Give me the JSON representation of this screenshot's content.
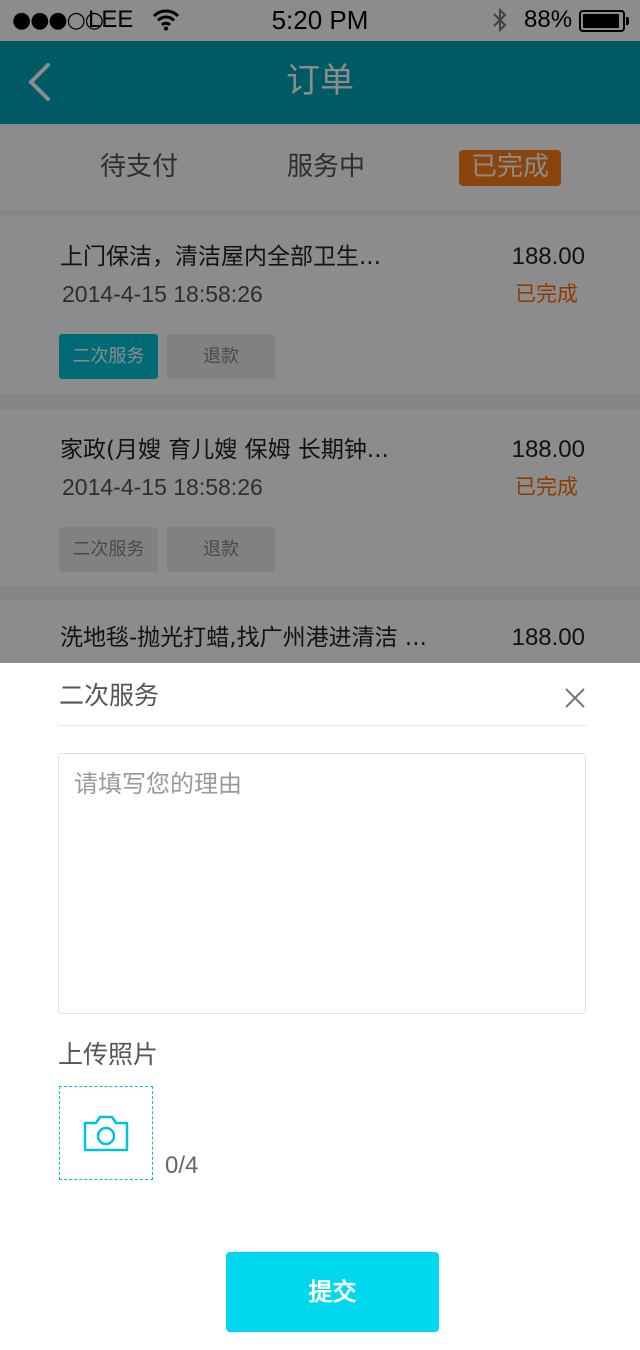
{
  "status_bar": {
    "signal": "●●●○○",
    "carrier": "LEE",
    "time": "5:20 PM",
    "battery_percent": "88%",
    "battery_level": 0.88
  },
  "nav": {
    "title": "订单",
    "back_icon": "chevron-left-icon"
  },
  "tabs": [
    {
      "label": "待支付",
      "active": false
    },
    {
      "label": "服务中",
      "active": false
    },
    {
      "label": "已完成",
      "active": true
    }
  ],
  "orders": [
    {
      "name": "上门保洁，清洁屋内全部卫生...",
      "date": "2014-4-15   18:58:26",
      "price": "188.00",
      "status": "已完成",
      "actions": [
        "二次服务",
        "退款"
      ],
      "primary_active": true
    },
    {
      "name": "家政(月嫂 育儿嫂 保姆 长期钟...",
      "date": "2014-4-15   18:58:26",
      "price": "188.00",
      "status": "已完成",
      "actions": [
        "二次服务",
        "退款"
      ],
      "primary_active": false
    },
    {
      "name": "洗地毯-抛光打蜡,找广州港进清洁 ...",
      "price": "188.00"
    }
  ],
  "sheet": {
    "title": "二次服务",
    "close_icon": "close-icon",
    "reason_placeholder": "请填写您的理由",
    "reason_value": "",
    "upload_label": "上传照片",
    "upload_icon": "camera-icon",
    "upload_count": "0/4",
    "submit_label": "提交"
  },
  "colors": {
    "nav_bg": "#00a5b8",
    "accent": "#00c3d9",
    "submit": "#00d8f0",
    "status_orange": "#ff6a00",
    "active_tab": "#ff7d19"
  }
}
